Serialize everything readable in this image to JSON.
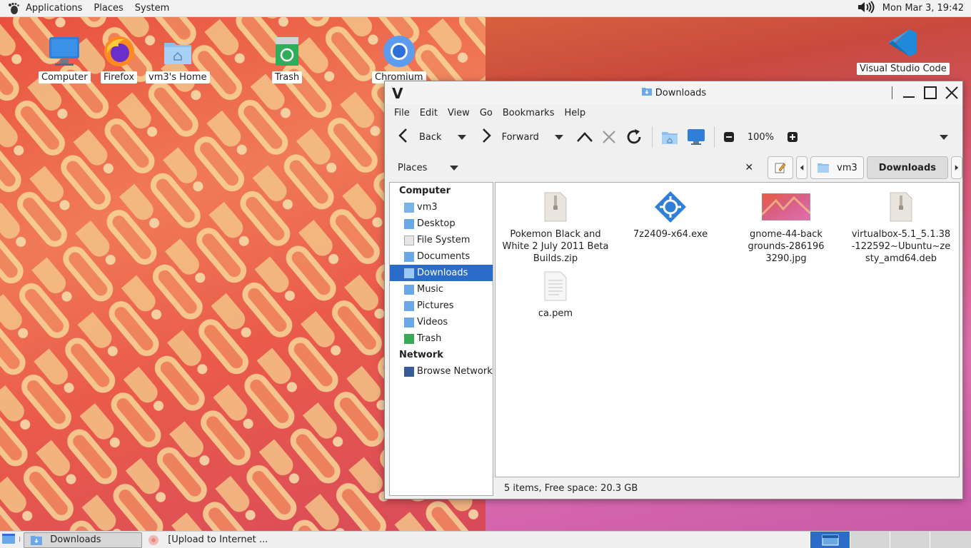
{
  "top_panel": {
    "menus": [
      "Applications",
      "Places",
      "System"
    ],
    "clock": "Mon Mar 3, 19:42"
  },
  "desktop_icons": [
    {
      "label": "Computer"
    },
    {
      "label": "Firefox"
    },
    {
      "label": "vm3's Home"
    },
    {
      "label": "Trash"
    },
    {
      "label": "Chromium"
    },
    {
      "label": "Visual Studio Code"
    }
  ],
  "window": {
    "title": "Downloads",
    "menubar": [
      "File",
      "Edit",
      "View",
      "Go",
      "Bookmarks",
      "Help"
    ],
    "toolbar": {
      "back_label": "Back",
      "forward_label": "Forward",
      "zoom": "100%"
    },
    "places_label": "Places",
    "breadcrumb": [
      "vm3",
      "Downloads"
    ],
    "sidebar": {
      "computer_heading": "Computer",
      "computer_items": [
        "vm3",
        "Desktop",
        "File System",
        "Documents",
        "Downloads",
        "Music",
        "Pictures",
        "Videos",
        "Trash"
      ],
      "network_heading": "Network",
      "network_items": [
        "Browse Network"
      ]
    },
    "files": [
      {
        "name": "Pokemon Black and White 2 July 2011 Beta Builds.zip",
        "icon": "zip-file-icon"
      },
      {
        "name": "7z2409-x64.exe",
        "icon": "exe-file-icon"
      },
      {
        "name": "gnome-44-backgrounds-2861963290.jpg",
        "icon": "image-thumbnail-icon"
      },
      {
        "name": "virtualbox-5.1_5.1.38-122592~Ubuntu~zesty_amd64.deb",
        "icon": "deb-file-icon"
      },
      {
        "name": "ca.pem",
        "icon": "text-file-icon"
      }
    ],
    "status": "5 items, Free space: 20.3 GB"
  },
  "bottom_panel": {
    "tasks": [
      "Downloads",
      "[Upload to Internet ..."
    ]
  }
}
